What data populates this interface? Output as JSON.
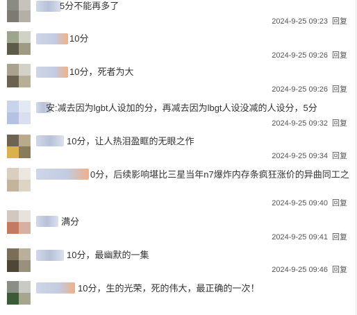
{
  "comments": [
    {
      "text": "5分不能再多了",
      "date": "2024-9-25 09:23",
      "reply": "回复"
    },
    {
      "text": "10分",
      "date": "2024-9-25 09:26",
      "reply": "回复"
    },
    {
      "text": "10分，死者为大",
      "date": "2024-9-25 09:26",
      "reply": "回复"
    },
    {
      "text": "减去因为lgbt人设加的分，再减去因为lbgt人设没减的人设分，5分",
      "date": "2024-9-25 09:32",
      "reply": "回复"
    },
    {
      "text": "10分，让人热泪盈眶的无眼之作",
      "date": "2024-9-25 09:34",
      "reply": "回复"
    },
    {
      "text": "0分，后续影响堪比三星当年n7爆炸内存条疯狂涨价的异曲同工之",
      "date": "2024-9-25 09:40",
      "reply": "回复"
    },
    {
      "text": "满分",
      "date": "2024-9-25 09:41",
      "reply": "回复"
    },
    {
      "text": "10分，最幽默的一集",
      "date": "2024-9-25 09:46",
      "reply": "回复"
    },
    {
      "text": "10分，生的光荣，死的伟大，最正确的一次！",
      "date": "",
      "reply": ""
    }
  ],
  "name_fragments": [
    "",
    "",
    "",
    "安:",
    "",
    "",
    "",
    "",
    ""
  ]
}
